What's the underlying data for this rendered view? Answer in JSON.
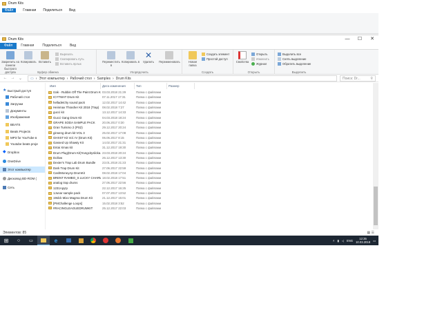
{
  "ghost": {
    "title": "Drum Kits",
    "tabs": [
      "Файл",
      "Главная",
      "Поделиться",
      "Вид"
    ]
  },
  "window": {
    "title": "Drum Kits",
    "controls": [
      "—",
      "☐",
      "✕"
    ]
  },
  "tabs": [
    "Файл",
    "Главная",
    "Поделиться",
    "Вид"
  ],
  "ribbon": {
    "pin_label": "Закрепить на панели быстрого доступа",
    "copy_label": "Копировать",
    "paste_label": "Вставить",
    "cut_label": "Вырезать",
    "copy_path_label": "Скопировать путь",
    "paste_shortcut_label": "Вставить ярлык",
    "clipboard_group": "Буфер обмена",
    "move_label": "Переместить в",
    "copyto_label": "Копировать в",
    "delete_label": "Удалить",
    "rename_label": "Переименовать",
    "organize_group": "Упорядочить",
    "newfolder_label": "Новая папка",
    "newitem_label": "Создать элемент",
    "easyaccess_label": "Простой доступ",
    "create_group": "Создать",
    "properties_label": "Свойства",
    "open_label": "Открыть",
    "edit_label": "Изменить",
    "history_label": "Журнал",
    "open_group": "Открыть",
    "selectall_label": "Выделить все",
    "selectnone_label": "Снять выделение",
    "invert_label": "Обратить выделение",
    "select_group": "Выделить"
  },
  "address": {
    "path": [
      "Этот компьютер",
      "Рабочий стол",
      "Samples",
      "Drum Kits"
    ],
    "search_placeholder": "Поиск: Dr..."
  },
  "nav": [
    {
      "label": "Быстрый доступ",
      "icon": "star-icon"
    },
    {
      "label": "Рабочий стол",
      "icon": "desktop-icon"
    },
    {
      "label": "Загрузки",
      "icon": "download-icon"
    },
    {
      "label": "Документы",
      "icon": "documents-icon"
    },
    {
      "label": "Изображения",
      "icon": "pictures-icon"
    },
    {
      "label": "BEATS",
      "icon": "folder-icon"
    },
    {
      "label": "Beats Projects",
      "icon": "folder-icon"
    },
    {
      "label": "MP3 for YouTube в",
      "icon": "folder-icon"
    },
    {
      "label": "Youtube beats proje",
      "icon": "folder-icon"
    },
    {
      "label": "Dropbox",
      "icon": "dropbox-icon"
    },
    {
      "label": "OneDrive",
      "icon": "cloud-icon"
    },
    {
      "label": "Этот компьютер",
      "icon": "computer-icon"
    },
    {
      "label": "Дисковод BD-ROM (",
      "icon": "disc-icon"
    },
    {
      "label": "Сеть",
      "icon": "network-icon"
    }
  ],
  "columns": [
    "Имя",
    "Дата изменения",
    "Тип",
    "Размер"
  ],
  "files": [
    {
      "name": "Izak - Rubbin Off The Paint Drum Kit",
      "date": "03.03.2018 21:29",
      "type": "Папка с файлами"
    },
    {
      "name": "ICYTWAT Drum Kit",
      "date": "07.11.2017 17:31",
      "type": "Папка с файлами"
    },
    {
      "name": "helladetchy sound pack",
      "date": "12.02.2017 14:42",
      "type": "Папка с файлами"
    },
    {
      "name": "Heinmax Thrasher Kit 2018 (Trap)",
      "date": "08.02.2018 7:27",
      "type": "Папка с файлами"
    },
    {
      "name": "gucci kit",
      "date": "13.12.2017 14:33",
      "type": "Папка с файлами"
    },
    {
      "name": "Gucci Gang Drum Kit",
      "date": "04.03.2018 18:24",
      "type": "Папка с файлами"
    },
    {
      "name": "GRAPE SODA SAMPLE PACK",
      "date": "20.06.2017 0:30",
      "type": "Папка с файлами"
    },
    {
      "name": "Gran Turismo 2 (PS2)",
      "date": "29.12.2017 20:24",
      "type": "Папка с файлами"
    },
    {
      "name": "ginseng drum kit VOL 3",
      "date": "25.02.2017 17:08",
      "type": "Папка с файлами"
    },
    {
      "name": "GHXST Kit Vol. IV (Drum Kit)",
      "date": "06.06.2017 8:15",
      "type": "Папка с файлами"
    },
    {
      "name": "Gassed Up Shawty Kit",
      "date": "14.02.2017 21:31",
      "type": "Папка с файлами"
    },
    {
      "name": "Entai Xmas kit",
      "date": "31.12.2017 19:30",
      "type": "Папка с файлами"
    },
    {
      "name": "Drum Plug(Drum Kit)Yungcityslicka.com",
      "date": "23.03.2018 20:24",
      "type": "Папка с файлами"
    },
    {
      "name": "Dollow",
      "date": "26.12.2017 13:30",
      "type": "Папка с файлами"
    },
    {
      "name": "Dexter's Trap Lab Drum Bundle",
      "date": "23.01.2018 21:23",
      "type": "Папка с файлами"
    },
    {
      "name": "Dark Trap Drum Kit",
      "date": "27.06.2017 22:59",
      "type": "Папка с файлами"
    },
    {
      "name": "CashMoneyAp DrumKit",
      "date": "08.02.2018 17:04",
      "type": "Папка с файлами"
    },
    {
      "name": "BRENT RAMBO_S LUCKY CHARMS 1 + 2",
      "date": "18.02.2018 17:51",
      "type": "Папка с файлами"
    },
    {
      "name": "analog trap drums",
      "date": "27.06.2017 22:56",
      "type": "Папка с файлами"
    },
    {
      "name": "1231Ару!р",
      "date": "22.12.2017 16:25",
      "type": "Папка с файлами"
    },
    {
      "name": "1Junar sample pack",
      "date": "07.07.2017 13:52",
      "type": "Папка с файлами"
    },
    {
      "name": "19slck Mixx Magma Drum Kit",
      "date": "21.12.2017 15:01",
      "type": "Папка с файлами"
    },
    {
      "name": "[PMChallenge Loops]",
      "date": "15.02.2018 3:52",
      "type": "Папка с файлами"
    },
    {
      "name": "#RACINGLEAGUEDRUMKIT",
      "date": "25.12.2017 22:03",
      "type": "Папка с файлами"
    }
  ],
  "status": {
    "items": "Элементов: 85"
  },
  "taskbar": {
    "lang": "ENG",
    "time": "12:35",
    "date": "10.03.2018"
  },
  "colors": {
    "file_tab": "#1979ca",
    "selection": "#cce8ff",
    "taskbar": "#1d2733",
    "folder": "#f0c85a"
  }
}
